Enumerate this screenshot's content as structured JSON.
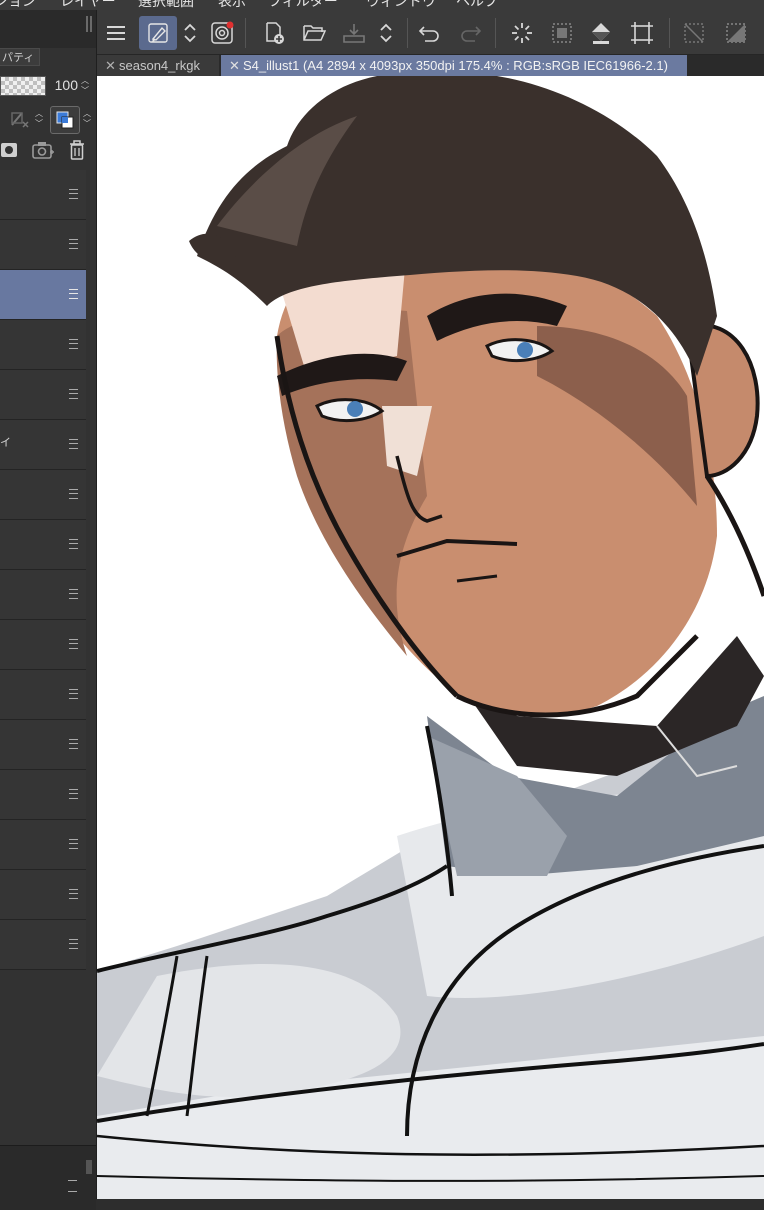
{
  "menubar": {
    "items": [
      "ション",
      "レイヤー",
      "選択範囲",
      "表示",
      "フィルター",
      "ウィンドウ",
      "ヘルプ"
    ]
  },
  "left_panel": {
    "tab_label": "パティ",
    "opacity_value": "100",
    "layers": [
      {
        "name": "",
        "selected": false
      },
      {
        "name": "",
        "selected": false
      },
      {
        "name": "",
        "selected": true
      },
      {
        "name": "",
        "selected": false
      },
      {
        "name": "",
        "selected": false
      },
      {
        "name": "イ",
        "selected": false
      },
      {
        "name": "",
        "selected": false
      },
      {
        "name": "",
        "selected": false
      },
      {
        "name": "",
        "selected": false
      },
      {
        "name": "",
        "selected": false
      },
      {
        "name": "",
        "selected": false
      },
      {
        "name": "",
        "selected": false
      },
      {
        "name": "",
        "selected": false
      },
      {
        "name": "",
        "selected": false
      },
      {
        "name": "",
        "selected": false
      },
      {
        "name": "",
        "selected": false
      }
    ]
  },
  "toolbar": {
    "icons": [
      "menu-icon",
      "subtool-pen-icon",
      "updown-icon",
      "spiral-icon",
      "new-file-icon",
      "open-folder-icon",
      "save-icon",
      "updown-icon",
      "undo-icon",
      "redo-icon",
      "loading-spinner-icon",
      "select-all-icon",
      "fill-bucket-icon",
      "transform-icon",
      "deselect-icon",
      "invert-selection-icon"
    ]
  },
  "document_tabs": [
    {
      "label": "season4_rkgk",
      "active": false
    },
    {
      "label": "S4_illust1 (A4 2894 x 4093px 350dpi 175.4% : RGB:sRGB IEC61966-2.1)",
      "active": true
    }
  ],
  "colors": {
    "accent": "#6b7aa0",
    "panel_bg": "#323232",
    "toolbar_bg": "#3a3a3a",
    "selected_layer": "#6878a0"
  }
}
